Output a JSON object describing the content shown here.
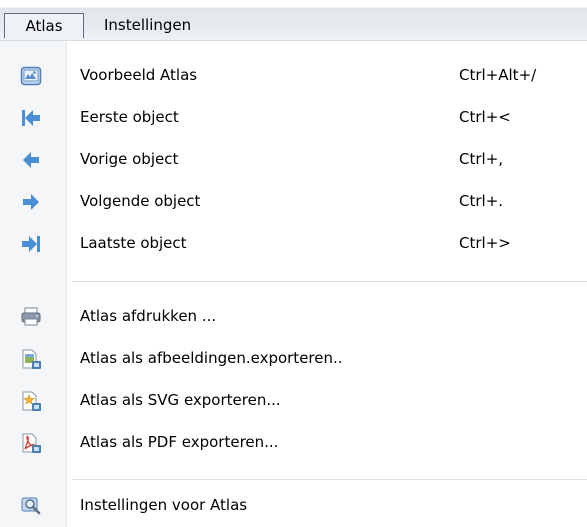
{
  "menubar": {
    "items": [
      "Atlas",
      "Instellingen"
    ]
  },
  "menu": {
    "groups": [
      [
        {
          "label": "Voorbeeld Atlas",
          "shortcut": "Ctrl+Alt+/",
          "icon": "preview-atlas-icon"
        },
        {
          "label": "Eerste object",
          "shortcut": "Ctrl+<",
          "icon": "first-feature-icon"
        },
        {
          "label": "Vorige object",
          "shortcut": "Ctrl+,",
          "icon": "previous-feature-icon"
        },
        {
          "label": "Volgende object",
          "shortcut": "Ctrl+.",
          "icon": "next-feature-icon"
        },
        {
          "label": "Laatste object",
          "shortcut": "Ctrl+>",
          "icon": "last-feature-icon"
        }
      ],
      [
        {
          "label": "Atlas afdrukken ...",
          "icon": "printer-icon"
        },
        {
          "label": "Atlas als afbeeldingen.exporteren..",
          "icon": "export-image-icon"
        },
        {
          "label": "Atlas als SVG exporteren...",
          "icon": "export-svg-icon"
        },
        {
          "label": "Atlas als PDF exporteren...",
          "icon": "export-pdf-icon"
        }
      ],
      [
        {
          "label": "Instellingen voor Atlas",
          "icon": "atlas-settings-icon"
        }
      ]
    ]
  },
  "colors": {
    "arrow_blue": "#4a8fd6",
    "menubar_bg": "#eef1f5",
    "icon_column_bg": "#f4f6f8"
  }
}
